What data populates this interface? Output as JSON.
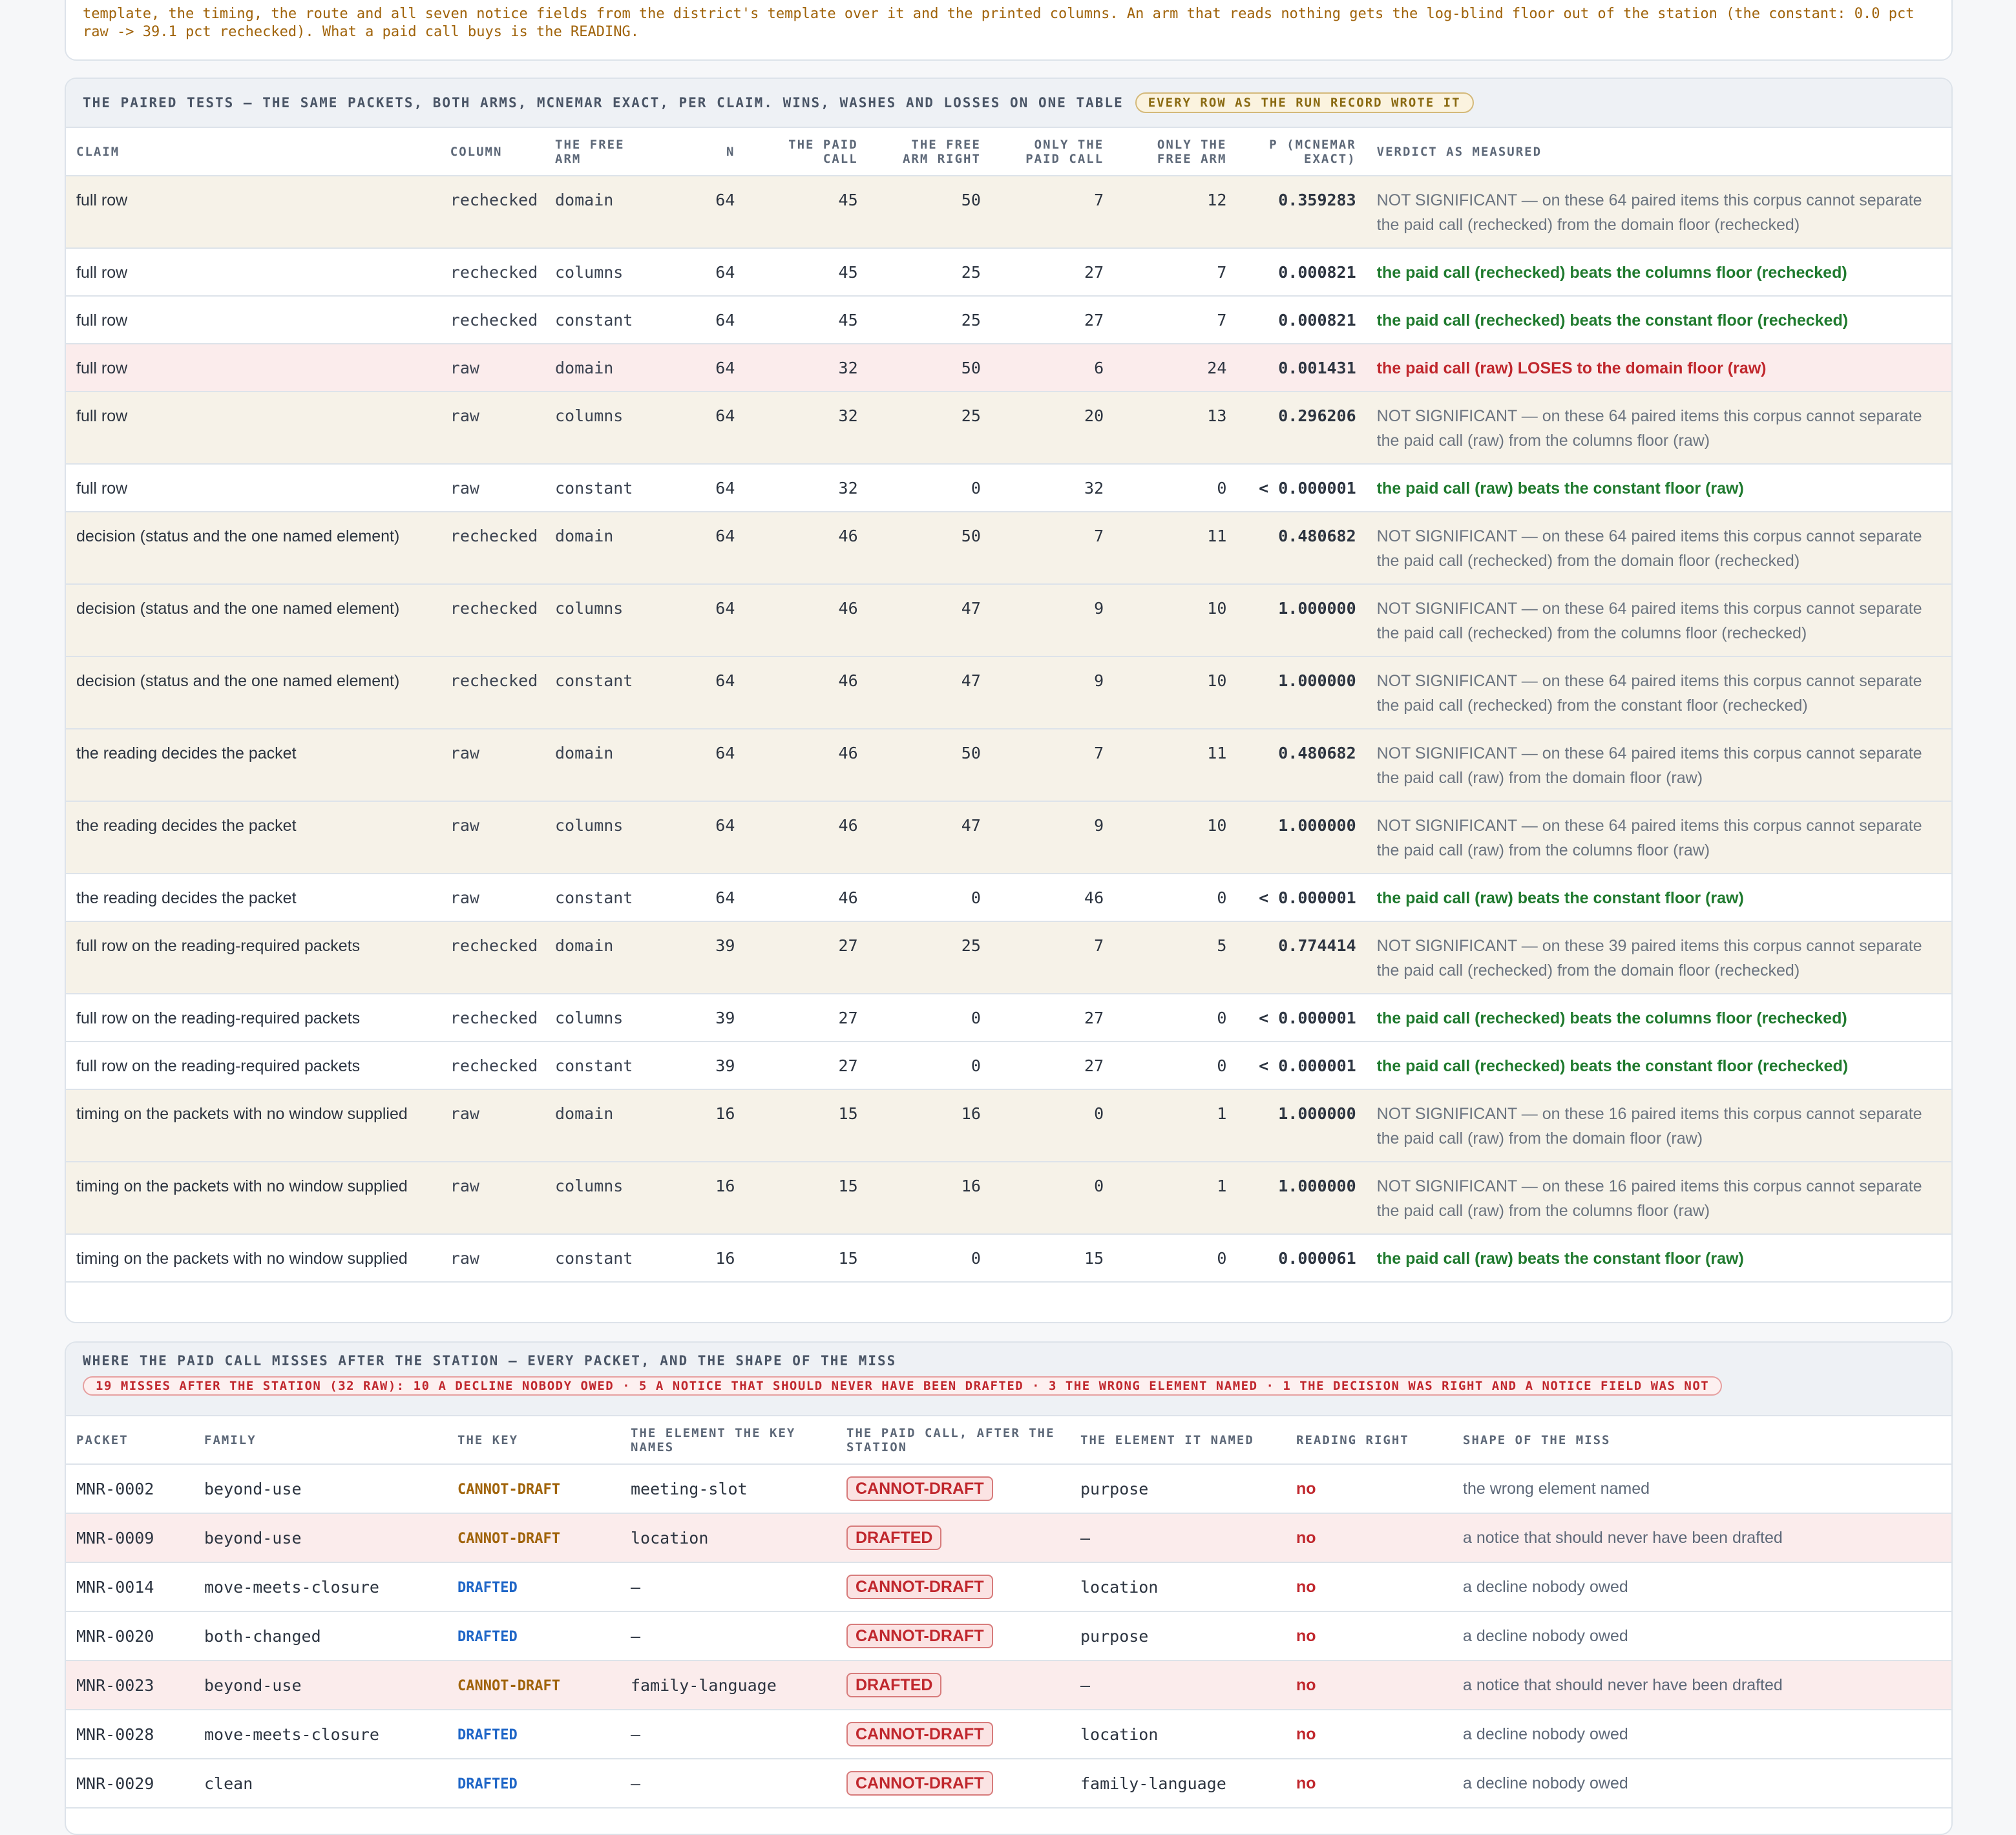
{
  "note": {
    "text": "template, the timing, the route and all seven notice fields from the district's template over it and the printed columns. An arm that reads nothing gets the log-blind floor out of the station (the constant: 0.0 pct\nraw -> 39.1 pct rechecked). What a paid call buys is the READING."
  },
  "paired": {
    "title": "THE PAIRED TESTS — THE SAME PACKETS, BOTH ARMS, MCNEMAR EXACT, PER CLAIM. WINS, WASHES AND LOSSES ON ONE TABLE",
    "badge": "EVERY ROW AS THE RUN RECORD WROTE IT",
    "headers": [
      "CLAIM",
      "COLUMN",
      "THE FREE ARM",
      "N",
      "THE PAID CALL",
      "THE FREE ARM RIGHT",
      "ONLY THE PAID CALL",
      "ONLY THE FREE ARM",
      "P (MCNEMAR EXACT)",
      "VERDICT AS MEASURED"
    ],
    "rows": [
      {
        "claim": "full row",
        "column": "rechecked",
        "arm": "domain",
        "n": "64",
        "paid": "45",
        "free": "50",
        "only_paid": "7",
        "only_free": "12",
        "p": "0.359283",
        "verdict": "NOT SIGNIFICANT — on these 64 paired items this corpus cannot separate the paid call (rechecked) from the domain floor (rechecked)",
        "kind": "neutral"
      },
      {
        "claim": "full row",
        "column": "rechecked",
        "arm": "columns",
        "n": "64",
        "paid": "45",
        "free": "25",
        "only_paid": "27",
        "only_free": "7",
        "p": "0.000821",
        "verdict": "the paid call (rechecked) beats the columns floor (rechecked)",
        "kind": "win"
      },
      {
        "claim": "full row",
        "column": "rechecked",
        "arm": "constant",
        "n": "64",
        "paid": "45",
        "free": "25",
        "only_paid": "27",
        "only_free": "7",
        "p": "0.000821",
        "verdict": "the paid call (rechecked) beats the constant floor (rechecked)",
        "kind": "win"
      },
      {
        "claim": "full row",
        "column": "raw",
        "arm": "domain",
        "n": "64",
        "paid": "32",
        "free": "50",
        "only_paid": "6",
        "only_free": "24",
        "p": "0.001431",
        "verdict": "the paid call (raw) LOSES to the domain floor (raw)",
        "kind": "loss"
      },
      {
        "claim": "full row",
        "column": "raw",
        "arm": "columns",
        "n": "64",
        "paid": "32",
        "free": "25",
        "only_paid": "20",
        "only_free": "13",
        "p": "0.296206",
        "verdict": "NOT SIGNIFICANT — on these 64 paired items this corpus cannot separate the paid call (raw) from the columns floor (raw)",
        "kind": "neutral"
      },
      {
        "claim": "full row",
        "column": "raw",
        "arm": "constant",
        "n": "64",
        "paid": "32",
        "free": "0",
        "only_paid": "32",
        "only_free": "0",
        "p": "< 0.000001",
        "verdict": "the paid call (raw) beats the constant floor (raw)",
        "kind": "win"
      },
      {
        "claim": "decision (status and the one named element)",
        "column": "rechecked",
        "arm": "domain",
        "n": "64",
        "paid": "46",
        "free": "50",
        "only_paid": "7",
        "only_free": "11",
        "p": "0.480682",
        "verdict": "NOT SIGNIFICANT — on these 64 paired items this corpus cannot separate the paid call (rechecked) from the domain floor (rechecked)",
        "kind": "neutral"
      },
      {
        "claim": "decision (status and the one named element)",
        "column": "rechecked",
        "arm": "columns",
        "n": "64",
        "paid": "46",
        "free": "47",
        "only_paid": "9",
        "only_free": "10",
        "p": "1.000000",
        "verdict": "NOT SIGNIFICANT — on these 64 paired items this corpus cannot separate the paid call (rechecked) from the columns floor (rechecked)",
        "kind": "neutral"
      },
      {
        "claim": "decision (status and the one named element)",
        "column": "rechecked",
        "arm": "constant",
        "n": "64",
        "paid": "46",
        "free": "47",
        "only_paid": "9",
        "only_free": "10",
        "p": "1.000000",
        "verdict": "NOT SIGNIFICANT — on these 64 paired items this corpus cannot separate the paid call (rechecked) from the constant floor (rechecked)",
        "kind": "neutral"
      },
      {
        "claim": "the reading decides the packet",
        "column": "raw",
        "arm": "domain",
        "n": "64",
        "paid": "46",
        "free": "50",
        "only_paid": "7",
        "only_free": "11",
        "p": "0.480682",
        "verdict": "NOT SIGNIFICANT — on these 64 paired items this corpus cannot separate the paid call (raw) from the domain floor (raw)",
        "kind": "neutral"
      },
      {
        "claim": "the reading decides the packet",
        "column": "raw",
        "arm": "columns",
        "n": "64",
        "paid": "46",
        "free": "47",
        "only_paid": "9",
        "only_free": "10",
        "p": "1.000000",
        "verdict": "NOT SIGNIFICANT — on these 64 paired items this corpus cannot separate the paid call (raw) from the columns floor (raw)",
        "kind": "neutral"
      },
      {
        "claim": "the reading decides the packet",
        "column": "raw",
        "arm": "constant",
        "n": "64",
        "paid": "46",
        "free": "0",
        "only_paid": "46",
        "only_free": "0",
        "p": "< 0.000001",
        "verdict": "the paid call (raw) beats the constant floor (raw)",
        "kind": "win"
      },
      {
        "claim": "full row on the reading-required packets",
        "column": "rechecked",
        "arm": "domain",
        "n": "39",
        "paid": "27",
        "free": "25",
        "only_paid": "7",
        "only_free": "5",
        "p": "0.774414",
        "verdict": "NOT SIGNIFICANT — on these 39 paired items this corpus cannot separate the paid call (rechecked) from the domain floor (rechecked)",
        "kind": "neutral"
      },
      {
        "claim": "full row on the reading-required packets",
        "column": "rechecked",
        "arm": "columns",
        "n": "39",
        "paid": "27",
        "free": "0",
        "only_paid": "27",
        "only_free": "0",
        "p": "< 0.000001",
        "verdict": "the paid call (rechecked) beats the columns floor (rechecked)",
        "kind": "win"
      },
      {
        "claim": "full row on the reading-required packets",
        "column": "rechecked",
        "arm": "constant",
        "n": "39",
        "paid": "27",
        "free": "0",
        "only_paid": "27",
        "only_free": "0",
        "p": "< 0.000001",
        "verdict": "the paid call (rechecked) beats the constant floor (rechecked)",
        "kind": "win"
      },
      {
        "claim": "timing on the packets with no window supplied",
        "column": "raw",
        "arm": "domain",
        "n": "16",
        "paid": "15",
        "free": "16",
        "only_paid": "0",
        "only_free": "1",
        "p": "1.000000",
        "verdict": "NOT SIGNIFICANT — on these 16 paired items this corpus cannot separate the paid call (raw) from the domain floor (raw)",
        "kind": "neutral"
      },
      {
        "claim": "timing on the packets with no window supplied",
        "column": "raw",
        "arm": "columns",
        "n": "16",
        "paid": "15",
        "free": "16",
        "only_paid": "0",
        "only_free": "1",
        "p": "1.000000",
        "verdict": "NOT SIGNIFICANT — on these 16 paired items this corpus cannot separate the paid call (raw) from the columns floor (raw)",
        "kind": "neutral"
      },
      {
        "claim": "timing on the packets with no window supplied",
        "column": "raw",
        "arm": "constant",
        "n": "16",
        "paid": "15",
        "free": "0",
        "only_paid": "15",
        "only_free": "0",
        "p": "0.000061",
        "verdict": "the paid call (raw) beats the constant floor (raw)",
        "kind": "win"
      }
    ]
  },
  "misses": {
    "title": "WHERE THE PAID CALL MISSES AFTER THE STATION — EVERY PACKET, AND THE SHAPE OF THE MISS",
    "summary": "19 MISSES AFTER THE STATION (32 RAW): 10 A DECLINE NOBODY OWED · 5 A NOTICE THAT SHOULD NEVER HAVE BEEN DRAFTED · 3 THE WRONG ELEMENT NAMED · 1 THE DECISION WAS RIGHT AND A NOTICE FIELD WAS NOT",
    "headers": [
      "PACKET",
      "FAMILY",
      "THE KEY",
      "THE ELEMENT THE KEY NAMES",
      "THE PAID CALL, AFTER THE STATION",
      "THE ELEMENT IT NAMED",
      "READING RIGHT",
      "SHAPE OF THE MISS"
    ],
    "rows": [
      {
        "packet": "MNR-0002",
        "family": "beyond-use",
        "key": "CANNOT-DRAFT",
        "key_el": "meeting-slot",
        "paid": "CANNOT-DRAFT",
        "paid_el": "purpose",
        "reading": "no",
        "shape": "the wrong element named",
        "highlight": false
      },
      {
        "packet": "MNR-0009",
        "family": "beyond-use",
        "key": "CANNOT-DRAFT",
        "key_el": "location",
        "paid": "DRAFTED",
        "paid_el": "—",
        "reading": "no",
        "shape": "a notice that should never have been drafted",
        "highlight": true
      },
      {
        "packet": "MNR-0014",
        "family": "move-meets-closure",
        "key": "DRAFTED",
        "key_el": "—",
        "paid": "CANNOT-DRAFT",
        "paid_el": "location",
        "reading": "no",
        "shape": "a decline nobody owed",
        "highlight": false
      },
      {
        "packet": "MNR-0020",
        "family": "both-changed",
        "key": "DRAFTED",
        "key_el": "—",
        "paid": "CANNOT-DRAFT",
        "paid_el": "purpose",
        "reading": "no",
        "shape": "a decline nobody owed",
        "highlight": false
      },
      {
        "packet": "MNR-0023",
        "family": "beyond-use",
        "key": "CANNOT-DRAFT",
        "key_el": "family-language",
        "paid": "DRAFTED",
        "paid_el": "—",
        "reading": "no",
        "shape": "a notice that should never have been drafted",
        "highlight": true
      },
      {
        "packet": "MNR-0028",
        "family": "move-meets-closure",
        "key": "DRAFTED",
        "key_el": "—",
        "paid": "CANNOT-DRAFT",
        "paid_el": "location",
        "reading": "no",
        "shape": "a decline nobody owed",
        "highlight": false
      },
      {
        "packet": "MNR-0029",
        "family": "clean",
        "key": "DRAFTED",
        "key_el": "—",
        "paid": "CANNOT-DRAFT",
        "paid_el": "family-language",
        "reading": "no",
        "shape": "a decline nobody owed",
        "highlight": false
      }
    ]
  }
}
